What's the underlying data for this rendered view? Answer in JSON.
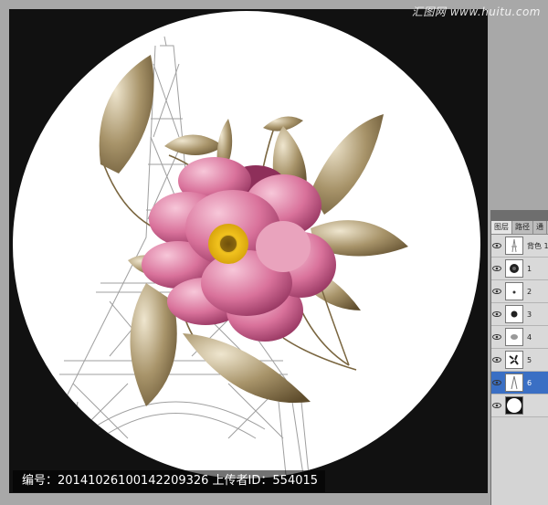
{
  "watermark": {
    "site": "汇图网 www.huitu.com"
  },
  "caption": {
    "text": "编号：20141026100142209326 上传者ID：554015"
  },
  "layers_panel": {
    "tabs": [
      "图层",
      "路径",
      "通"
    ],
    "layers": [
      {
        "name": "背色 1",
        "thumb": "tower-sketch-icon",
        "selected": false
      },
      {
        "name": "1",
        "thumb": "flower-icon",
        "selected": false
      },
      {
        "name": "2",
        "thumb": "dot-icon",
        "selected": false
      },
      {
        "name": "3",
        "thumb": "bud-icon",
        "selected": false
      },
      {
        "name": "4",
        "thumb": "leaf-icon",
        "selected": false
      },
      {
        "name": "5",
        "thumb": "leaves-icon",
        "selected": false
      },
      {
        "name": "6",
        "thumb": "tower-icon",
        "selected": true
      },
      {
        "name": "",
        "thumb": "circle-mask-icon",
        "selected": false
      }
    ]
  },
  "colors": {
    "canvas_background": "#111111",
    "circle": "#ffffff",
    "petal": "#d16b93",
    "leaf": "#8a7850",
    "selection": "#3a6fc4"
  }
}
